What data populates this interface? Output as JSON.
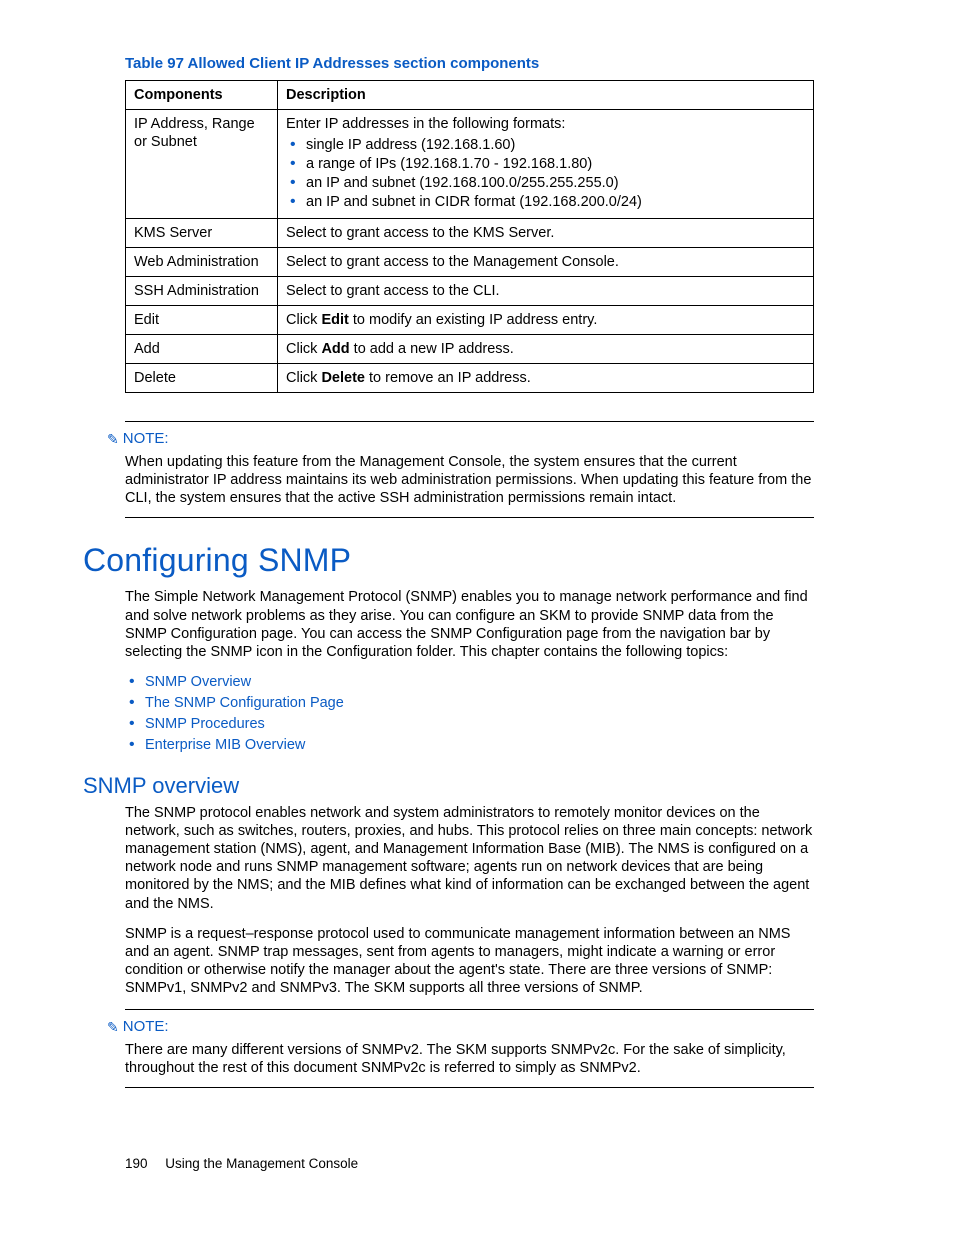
{
  "table": {
    "caption": "Table 97 Allowed Client IP Addresses section components",
    "headers": [
      "Components",
      "Description"
    ],
    "rows": [
      {
        "component": "IP Address, Range or Subnet",
        "intro": "Enter IP addresses in the following formats:",
        "bullets": [
          "single IP address (192.168.1.60)",
          "a range of IPs (192.168.1.70 - 192.168.1.80)",
          "an IP and subnet (192.168.100.0/255.255.255.0)",
          "an IP and subnet in CIDR format (192.168.200.0/24)"
        ]
      },
      {
        "component": "KMS Server",
        "description": "Select to grant access to the KMS Server."
      },
      {
        "component": "Web Administration",
        "description": "Select to grant access to the Management Console."
      },
      {
        "component": "SSH Administration",
        "description": "Select to grant access to the CLI."
      },
      {
        "component": "Edit",
        "pre": "Click ",
        "bold": "Edit",
        "post": " to modify an existing IP address entry."
      },
      {
        "component": "Add",
        "pre": "Click ",
        "bold": "Add",
        "post": " to add a new IP address."
      },
      {
        "component": "Delete",
        "pre": "Click ",
        "bold": "Delete",
        "post": " to remove an IP address."
      }
    ]
  },
  "note1": {
    "label": "NOTE:",
    "text": "When updating this feature from the Management Console, the system ensures that the current administrator IP address maintains its web administration permissions. When updating this feature from the CLI, the system ensures that the active SSH administration permissions remain intact."
  },
  "h1": "Configuring SNMP",
  "intro": "The Simple Network Management Protocol (SNMP) enables you to manage network performance and find and solve network problems as they arise. You can configure an SKM to provide SNMP data from the SNMP Configuration page. You can access the SNMP Configuration page from the navigation bar by selecting the SNMP icon in the Configuration folder. This chapter contains the following topics:",
  "links": [
    "SNMP Overview",
    "The SNMP Configuration Page",
    "SNMP Procedures",
    "Enterprise MIB Overview"
  ],
  "h2": "SNMP overview",
  "overview_p1": "The SNMP protocol enables network and system administrators to remotely monitor devices on the network, such as switches, routers, proxies, and hubs. This protocol relies on three main concepts: network management station (NMS), agent, and Management Information Base (MIB). The NMS is configured on a network node and runs SNMP management software; agents run on network devices that are being monitored by the NMS; and the MIB defines what kind of information can be exchanged between the agent and the NMS.",
  "overview_p2": "SNMP is a request–response protocol used to communicate management information between an NMS and an agent. SNMP trap messages, sent from agents to managers, might indicate a warning or error condition or otherwise notify the manager about the agent's state. There are three versions of SNMP: SNMPv1, SNMPv2 and SNMPv3. The SKM supports all three versions of SNMP.",
  "note2": {
    "label": "NOTE:",
    "text": "There are many different versions of SNMPv2. The SKM supports SNMPv2c. For the sake of simplicity, throughout the rest of this document SNMPv2c is referred to simply as SNMPv2."
  },
  "footer": {
    "page": "190",
    "title": "Using the Management Console"
  }
}
